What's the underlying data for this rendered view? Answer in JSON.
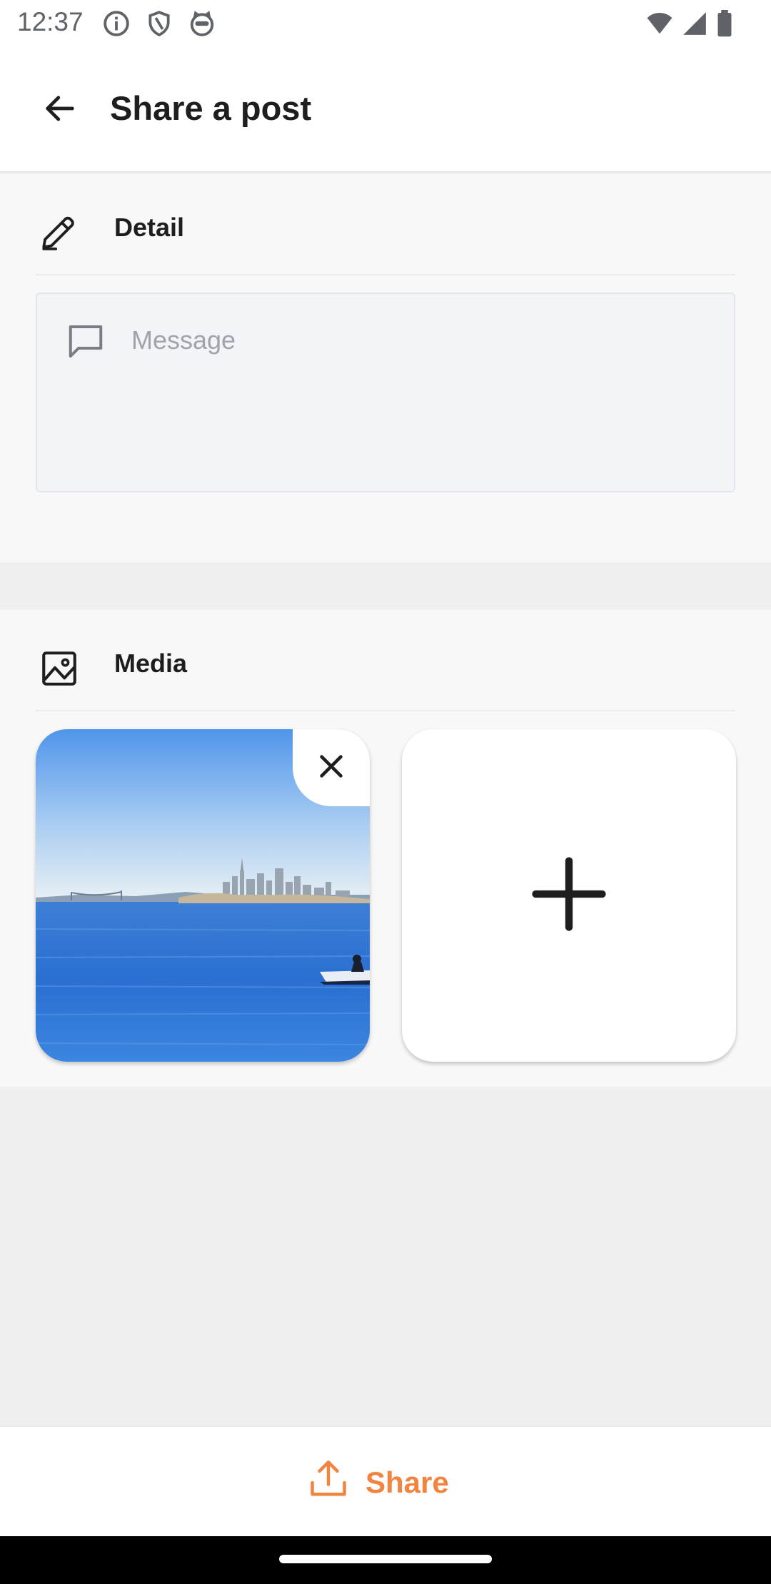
{
  "status_bar": {
    "time": "12:37",
    "left_icons": [
      "info-icon",
      "shield-icon",
      "cat-face-icon"
    ],
    "right_icons": [
      "wifi-icon",
      "cell-signal-icon",
      "battery-icon"
    ]
  },
  "header": {
    "title": "Share a post",
    "back_icon": "arrow-left-icon"
  },
  "detail": {
    "title": "Detail",
    "icon": "pencil-icon",
    "message_placeholder": "Message",
    "message_value": "",
    "message_icon": "chat-bubble-icon"
  },
  "media": {
    "title": "Media",
    "icon": "image-icon",
    "items": [
      {
        "type": "photo",
        "description_icon": "bay-skyline-photo",
        "remove_icon": "close-icon"
      }
    ],
    "add_icon": "plus-icon"
  },
  "share": {
    "label": "Share",
    "icon": "upload-icon",
    "color": "#f2843f"
  }
}
